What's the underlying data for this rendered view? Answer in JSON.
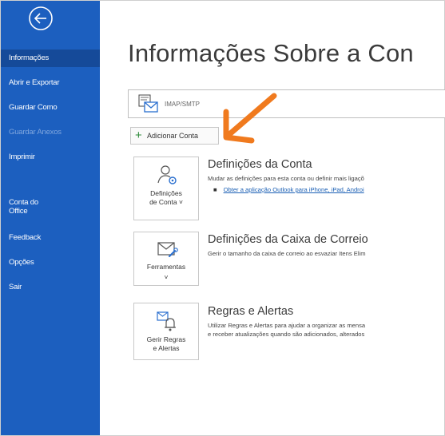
{
  "sidebar": {
    "items": [
      {
        "label": "Informações",
        "active": true
      },
      {
        "label": "Abrir e Exportar"
      },
      {
        "label": "Guardar Como"
      },
      {
        "label": "Guardar Anexos",
        "disabled": true
      },
      {
        "label": "Imprimir"
      },
      {
        "label": "Conta do Office"
      },
      {
        "label": "Feedback"
      },
      {
        "label": "Opções"
      },
      {
        "label": "Sair"
      }
    ]
  },
  "main": {
    "title": "Informações Sobre a Con",
    "account": {
      "type": "IMAP/SMTP"
    },
    "add_account_label": "Adicionar Conta",
    "sections": [
      {
        "tile_label_1": "Definições",
        "tile_label_2": "de Conta ˅",
        "title": "Definições da Conta",
        "desc": "Mudar as definições para esta conta ou definir mais ligaçõ",
        "link": "Obter a aplicação Outlook para iPhone, iPad, Androi"
      },
      {
        "tile_label_1": "Ferramentas",
        "tile_label_2": "˅",
        "title": "Definições da Caixa de Correio",
        "desc": "Gerir o tamanho da caixa de correio ao esvaziar Itens Elim"
      },
      {
        "tile_label_1": "Gerir Regras",
        "tile_label_2": "e Alertas",
        "title": "Regras e Alertas",
        "desc": "Utilizar Regras e Alertas para ajudar a organizar as mensa",
        "desc2": "e receber atualizações quando são adicionados, alterados"
      }
    ]
  },
  "colors": {
    "sidebar": "#1c5fbf",
    "active": "#154a99",
    "arrow": "#f07a1e",
    "link": "#1a5fb4"
  }
}
